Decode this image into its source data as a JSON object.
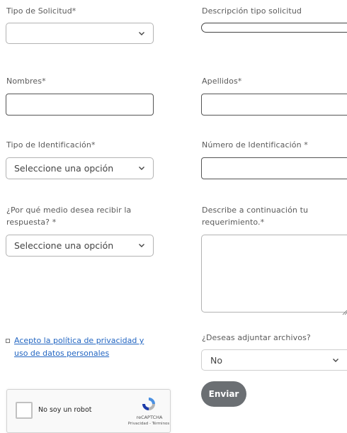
{
  "form": {
    "tipo_solicitud": {
      "label": "Tipo de Solicitud*",
      "value": ""
    },
    "descripcion_tipo": {
      "label": "Descripción tipo solicitud",
      "value": ""
    },
    "nombres": {
      "label": "Nombres*",
      "value": ""
    },
    "apellidos": {
      "label": "Apellidos*",
      "value": ""
    },
    "tipo_identificacion": {
      "label": "Tipo de Identificación*",
      "value": "Seleccione una opción"
    },
    "numero_identificacion": {
      "label": "Número de Identificación *",
      "value": ""
    },
    "medio_respuesta": {
      "label_line1": "¿Por qué medio desea recibir la",
      "label_line2": "respuesta? *",
      "value": "Seleccione una opción"
    },
    "requerimiento": {
      "label_line1": "Describe a continuación tu",
      "label_line2": "requerimiento.*",
      "value": ""
    },
    "politica": {
      "link_line1": "Acepto la política de privacidad y",
      "link_line2": "uso de datos personales"
    },
    "adjuntar": {
      "label": "¿Deseas adjuntar archivos?",
      "value": "No"
    },
    "submit_label": "Enviar"
  },
  "recaptcha": {
    "checkbox_label": "No soy un robot",
    "brand": "reCAPTCHA",
    "links": "Privacidad - Términos"
  },
  "colors": {
    "button": "#6b6f73",
    "link": "#2366c2",
    "recaptcha_blue": "#4a90e2"
  },
  "icons": {
    "select_indicator": "chevron-down-icon",
    "recaptcha_logo": "recaptcha-logo-icon",
    "resize_handle": "resize-handle-icon"
  }
}
